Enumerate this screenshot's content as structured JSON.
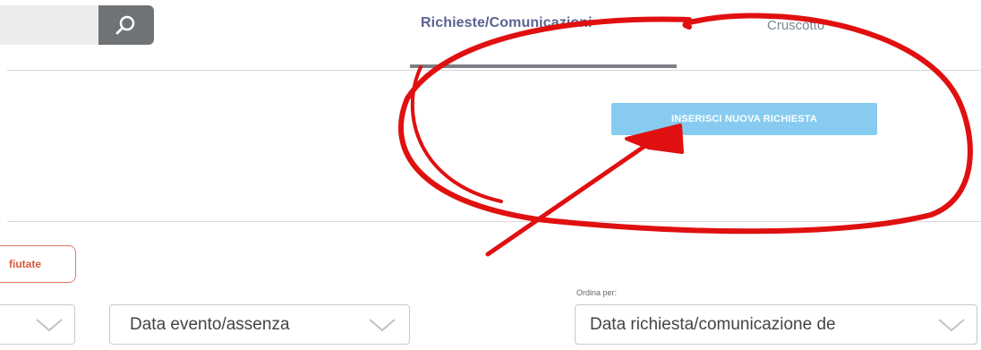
{
  "search": {
    "placeholder": "",
    "icon": "search-icon"
  },
  "tabs": [
    {
      "label": "Richieste/Comunicazioni",
      "active": true
    },
    {
      "label": "Cruscotto",
      "active": false
    }
  ],
  "actions": {
    "new_request_label": "INSERISCI NUOVA RICHIESTA"
  },
  "filters": {
    "rejected_label": "fiutate"
  },
  "selects": {
    "left_value": "",
    "event_value": "Data evento/assenza",
    "sort_label": "Ordina per:",
    "sort_value": "Data richiesta/comunicazione de"
  },
  "colors": {
    "accent_button": "#87ccf0",
    "tab_active": "#5a6290",
    "annotation": "#e01010",
    "filter_chip": "#d9583b"
  },
  "annotation": {
    "shape": "hand-drawn red circle and arrow pointing at new request button"
  }
}
